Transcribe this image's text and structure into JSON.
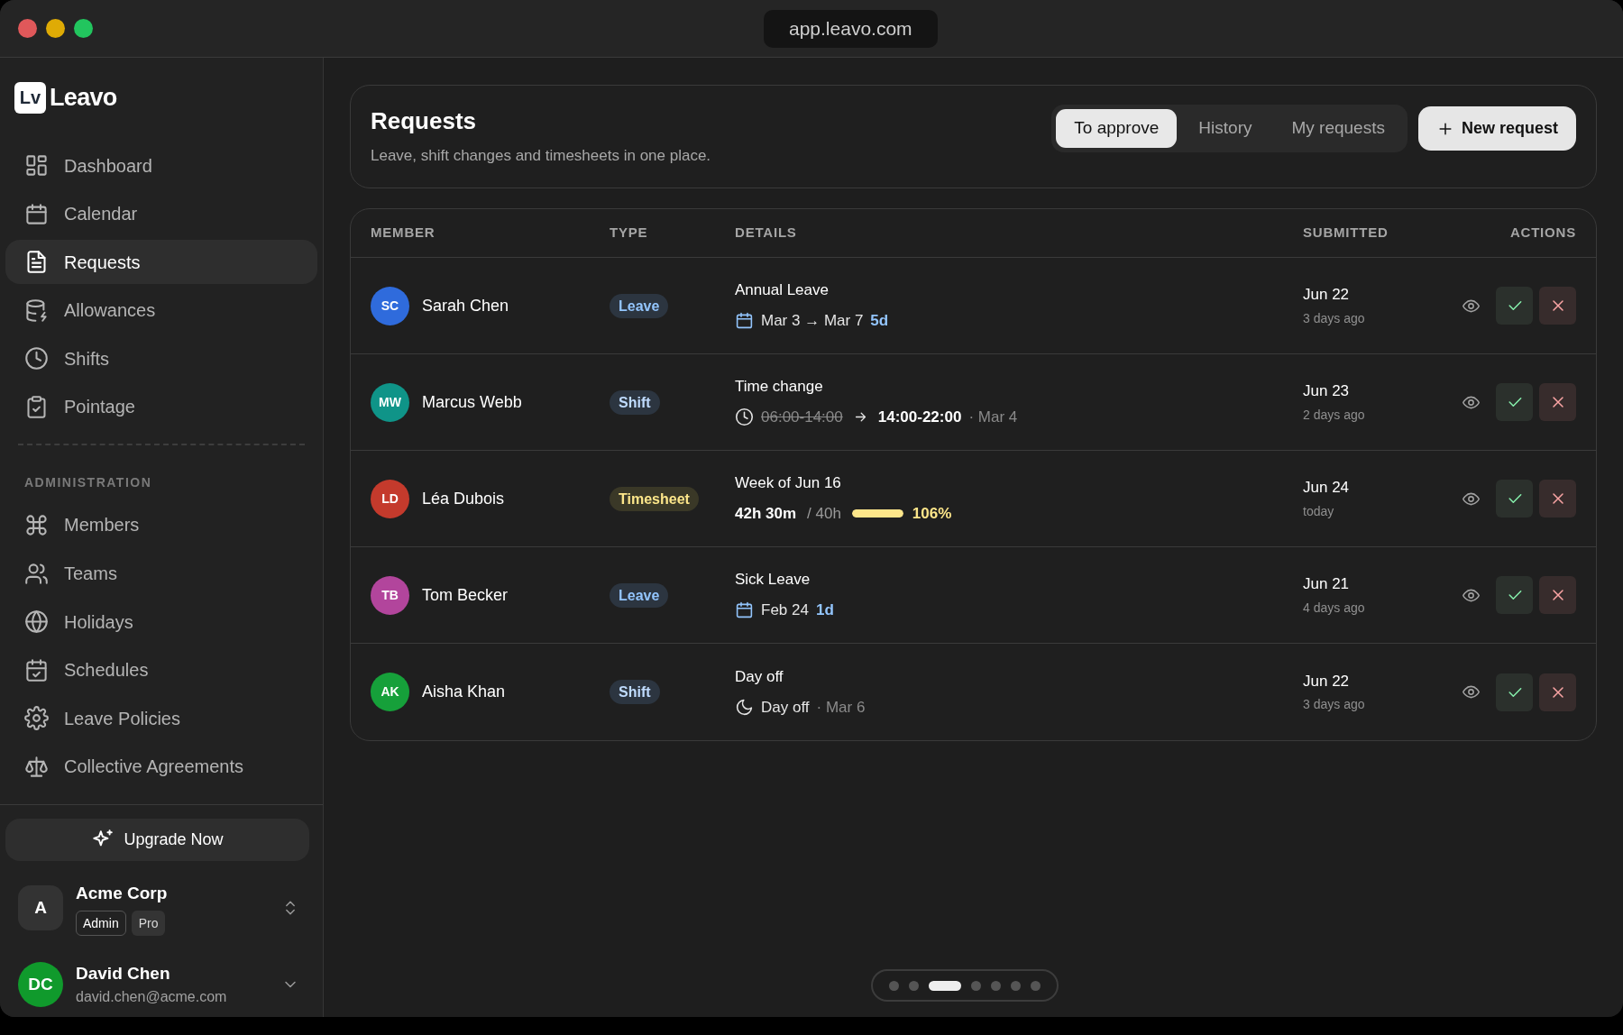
{
  "window": {
    "url": "app.leavo.com"
  },
  "sidebar": {
    "logo_mark": "Lv",
    "logo_text": "Leavo",
    "nav": [
      {
        "label": "Dashboard",
        "selected": false
      },
      {
        "label": "Calendar",
        "selected": false
      },
      {
        "label": "Requests",
        "selected": true
      },
      {
        "label": "Allowances",
        "selected": false
      },
      {
        "label": "Shifts",
        "selected": false
      },
      {
        "label": "Pointage",
        "selected": false
      }
    ],
    "section_title": "ADMINISTRATION",
    "admin_nav": [
      {
        "label": "Members",
        "selected": false
      },
      {
        "label": "Teams",
        "selected": false
      },
      {
        "label": "Holidays",
        "selected": false
      },
      {
        "label": "Schedules",
        "selected": false
      },
      {
        "label": "Leave Policies",
        "selected": false
      },
      {
        "label": "Collective Agreements",
        "selected": false
      }
    ],
    "upgrade": "Upgrade Now",
    "org": {
      "initial": "A",
      "name": "Acme Corp",
      "badges": [
        {
          "label": "Admin",
          "kind": "outline"
        },
        {
          "label": "Pro",
          "kind": "filled"
        }
      ]
    },
    "user": {
      "initials": "DC",
      "name": "David Chen",
      "email": "david.chen@acme.com",
      "color": "#109a2c"
    }
  },
  "header": {
    "title": "Requests",
    "subtitle": "Leave, shift changes and timesheets in one place.",
    "tabs": [
      {
        "label": "To approve",
        "selected": true
      },
      {
        "label": "History",
        "selected": false
      },
      {
        "label": "My requests",
        "selected": false
      }
    ],
    "new_button": "New request"
  },
  "table": {
    "columns": [
      "MEMBER",
      "TYPE",
      "DETAILS",
      "SUBMITTED",
      "ACTIONS"
    ],
    "rows": [
      {
        "member": {
          "initials": "SC",
          "name": "Sarah Chen",
          "color": "#2f6bdc"
        },
        "type": {
          "label": "Leave",
          "kind": "leave",
          "color": "#2c3540"
        },
        "details": {
          "kind": "range",
          "title": "Annual Leave",
          "text": "Mar 3 → Mar 7",
          "duration": "5d"
        },
        "submitted": {
          "date": "Jun 22",
          "ago": "3 days ago"
        }
      },
      {
        "member": {
          "initials": "MW",
          "name": "Marcus Webb",
          "color": "#0f9488"
        },
        "type": {
          "label": "Shift",
          "kind": "shift",
          "color": "#2c3540"
        },
        "details": {
          "kind": "time_change",
          "title": "Time change",
          "old": "06:00-14:00",
          "new": "14:00-22:00",
          "date": "· Mar 4"
        },
        "submitted": {
          "date": "Jun 23",
          "ago": "2 days ago"
        }
      },
      {
        "member": {
          "initials": "LD",
          "name": "Léa Dubois",
          "color": "#c43a2c"
        },
        "type": {
          "label": "Timesheet",
          "kind": "timesheet",
          "color": "#3a3827"
        },
        "details": {
          "kind": "timesheet",
          "title": "Week of Jun 16",
          "hours": "42h 30m",
          "target": "/ 40h",
          "level": 1,
          "percent": "106%"
        },
        "submitted": {
          "date": "Jun 24",
          "ago": "today"
        }
      },
      {
        "member": {
          "initials": "TB",
          "name": "Tom Becker",
          "color": "#b2459c"
        },
        "type": {
          "label": "Leave",
          "kind": "leave",
          "color": "#2c3540"
        },
        "details": {
          "kind": "range",
          "title": "Sick Leave",
          "text": "Feb 24",
          "duration": "1d"
        },
        "submitted": {
          "date": "Jun 21",
          "ago": "4 days ago"
        }
      },
      {
        "member": {
          "initials": "AK",
          "name": "Aisha Khan",
          "color": "#16a03a"
        },
        "type": {
          "label": "Shift",
          "kind": "shift",
          "color": "#2c3540"
        },
        "details": {
          "kind": "day_off",
          "title": "Day off",
          "text": "Day off",
          "date": "· Mar 6"
        },
        "submitted": {
          "date": "Jun 22",
          "ago": "3 days ago"
        }
      }
    ]
  },
  "pager": [
    {
      "selected": false
    },
    {
      "selected": false
    },
    {
      "selected": true
    },
    {
      "selected": false
    },
    {
      "selected": false
    },
    {
      "selected": false
    },
    {
      "selected": false
    }
  ]
}
